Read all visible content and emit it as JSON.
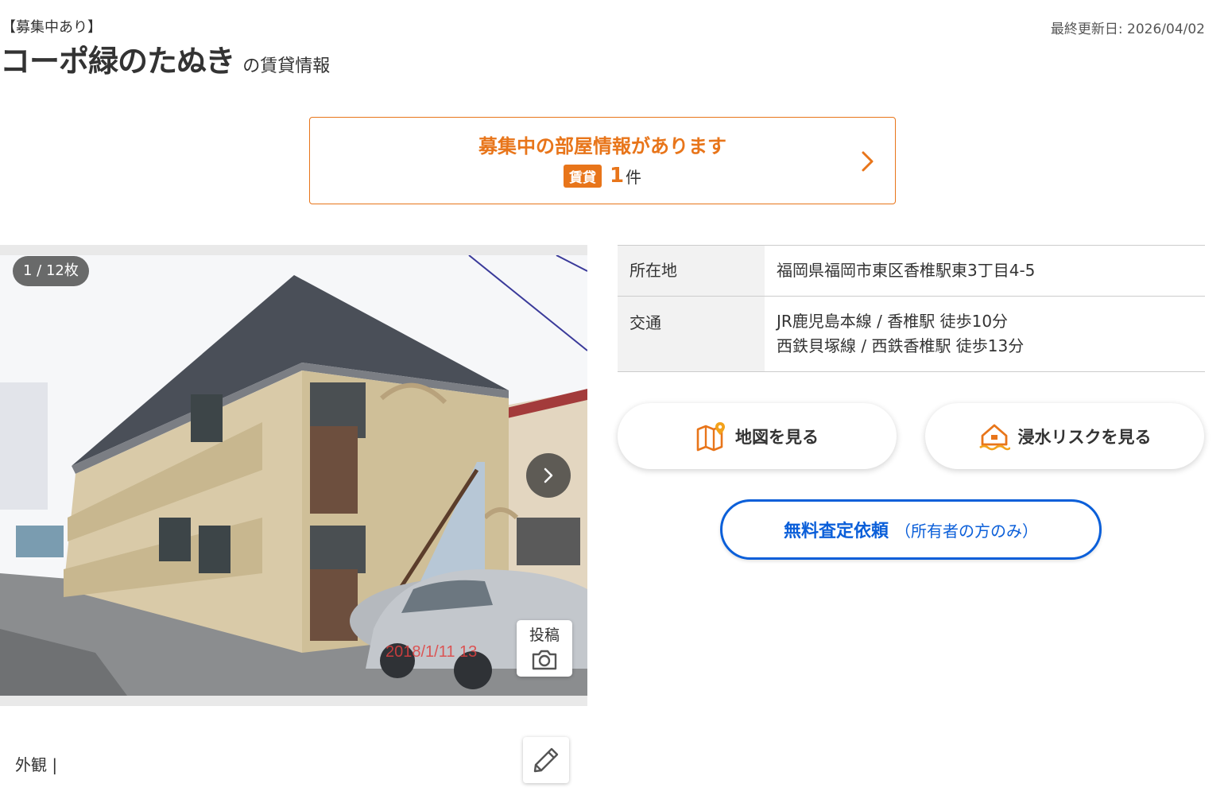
{
  "header": {
    "status_tag": "【募集中あり】",
    "title": "コーポ緑のたぬき",
    "title_suffix": "の賃貸情報",
    "last_updated": "最終更新日: 2026/04/02"
  },
  "vacancy_banner": {
    "title": "募集中の部屋情報があります",
    "badge": "賃貸",
    "count": "1",
    "unit": "件",
    "icon": "chevron-right-icon",
    "accent_color": "#e8751a"
  },
  "gallery": {
    "counter": "1 / 12枚",
    "post_label": "投稿",
    "caption": "外観 |",
    "icons": [
      "chevron-right-icon",
      "camera-icon",
      "pencil-icon"
    ]
  },
  "info": {
    "rows": [
      {
        "label": "所在地",
        "lines": [
          "福岡県福岡市東区香椎駅東3丁目4-5"
        ]
      },
      {
        "label": "交通",
        "lines": [
          "JR鹿児島本線 / 香椎駅 徒歩10分",
          "西鉄貝塚線 / 西鉄香椎駅 徒歩13分"
        ]
      }
    ]
  },
  "actions": {
    "map_label": "地図を見る",
    "map_icon": "map-pin-icon",
    "flood_label": "浸水リスクを見る",
    "flood_icon": "flood-house-icon",
    "appraisal_label": "無料査定依頼",
    "appraisal_note": "（所有者の方のみ）",
    "appraisal_color": "#0b5fd9"
  }
}
